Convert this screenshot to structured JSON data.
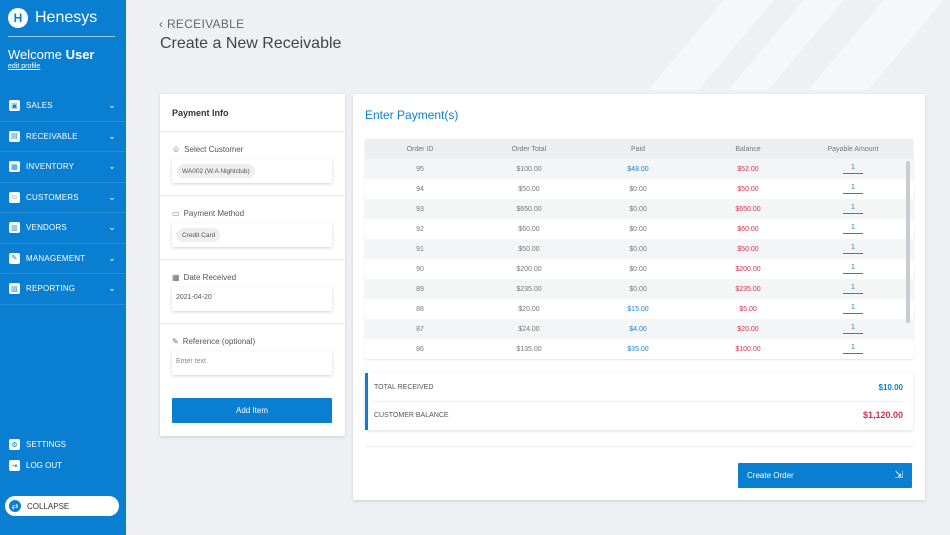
{
  "brand": {
    "name": "Henesys",
    "logo_letter": "H"
  },
  "user": {
    "welcome_prefix": "Welcome",
    "name": "User",
    "edit_profile": "edit profile"
  },
  "nav": [
    {
      "label": "SALES",
      "icon": "sales-icon",
      "glyph": "▣"
    },
    {
      "label": "RECEIVABLE",
      "icon": "receivable-icon",
      "glyph": "▤"
    },
    {
      "label": "INVENTORY",
      "icon": "inventory-icon",
      "glyph": "▦"
    },
    {
      "label": "CUSTOMERS",
      "icon": "customers-icon",
      "glyph": "☺"
    },
    {
      "label": "VENDORS",
      "icon": "vendors-icon",
      "glyph": "▥"
    },
    {
      "label": "MANAGEMENT",
      "icon": "management-icon",
      "glyph": "✎"
    },
    {
      "label": "REPORTING",
      "icon": "reporting-icon",
      "glyph": "▨"
    }
  ],
  "bottom_nav": {
    "settings": "SETTINGS",
    "logout": "LOG OUT",
    "collapse": "COLLAPSE"
  },
  "header": {
    "back_label": "RECEIVABLE",
    "title": "Create a New Receivable"
  },
  "payment_info": {
    "title": "Payment Info",
    "customer": {
      "label": "Select Customer",
      "value": "WA002 (W.A Nightclub)"
    },
    "method": {
      "label": "Payment Method",
      "value": "Credit Card"
    },
    "date": {
      "label": "Date Received",
      "value": "2021-04-20"
    },
    "reference": {
      "label": "Reference (optional)",
      "placeholder": "Enter text"
    },
    "add_item": "Add Item"
  },
  "payments": {
    "title": "Enter Payment(s)",
    "columns": [
      "Order ID",
      "Order Total",
      "Paid",
      "Balance",
      "Payable Amount"
    ],
    "rows": [
      {
        "id": "95",
        "total": "$100.00",
        "paid": "$48.00",
        "balance": "$52.00",
        "payable": "1",
        "paid_highlight": true
      },
      {
        "id": "94",
        "total": "$50.00",
        "paid": "$0.00",
        "balance": "$50.00",
        "payable": "1",
        "paid_highlight": false
      },
      {
        "id": "93",
        "total": "$650.00",
        "paid": "$0.00",
        "balance": "$650.00",
        "payable": "1",
        "paid_highlight": false
      },
      {
        "id": "92",
        "total": "$60.00",
        "paid": "$0.00",
        "balance": "$60.00",
        "payable": "1",
        "paid_highlight": false
      },
      {
        "id": "91",
        "total": "$50.00",
        "paid": "$0.00",
        "balance": "$50.00",
        "payable": "1",
        "paid_highlight": false
      },
      {
        "id": "90",
        "total": "$200.00",
        "paid": "$0.00",
        "balance": "$200.00",
        "payable": "1",
        "paid_highlight": false
      },
      {
        "id": "89",
        "total": "$235.00",
        "paid": "$0.00",
        "balance": "$235.00",
        "payable": "1",
        "paid_highlight": false
      },
      {
        "id": "88",
        "total": "$20.00",
        "paid": "$15.00",
        "balance": "$5.00",
        "payable": "1",
        "paid_highlight": true
      },
      {
        "id": "87",
        "total": "$24.00",
        "paid": "$4.00",
        "balance": "$20.00",
        "payable": "1",
        "paid_highlight": true
      },
      {
        "id": "86",
        "total": "$135.00",
        "paid": "$35.00",
        "balance": "$100.00",
        "payable": "1",
        "paid_highlight": true
      }
    ]
  },
  "totals": {
    "received_label": "TOTAL RECEIVED",
    "received_value": "$10.00",
    "balance_label": "CUSTOMER BALANCE",
    "balance_value": "$1,120.00"
  },
  "create_order": "Create Order",
  "colors": {
    "primary": "#0a7fd1",
    "negative": "#d0334b",
    "background": "#eef0f3"
  }
}
